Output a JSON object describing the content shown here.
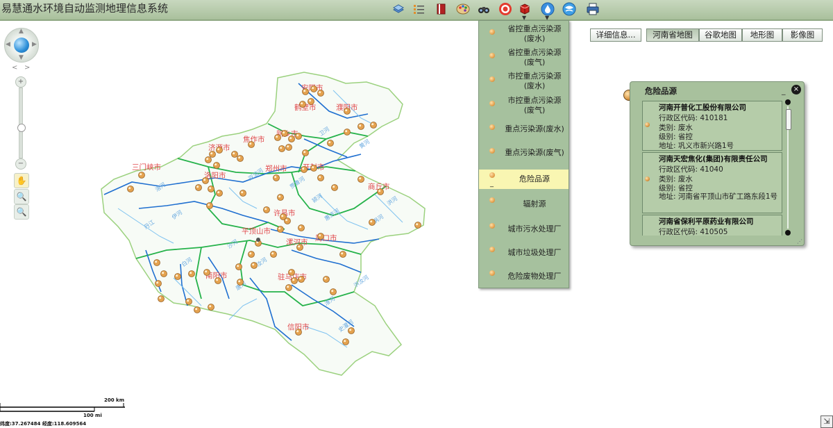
{
  "app": {
    "title": "易慧通水环境自动监测地理信息系统"
  },
  "toolbar": {
    "icons": [
      "layers-icon",
      "list-icon",
      "book-icon",
      "palette-icon",
      "binoculars-icon",
      "target-icon",
      "cube-icon",
      "water-drop-icon",
      "globe-icon",
      "printer-icon"
    ]
  },
  "map_types": {
    "detail_label": "详细信息...",
    "buttons": [
      "河南省地图",
      "谷歌地图",
      "地形图",
      "影像图"
    ],
    "active": "河南省地图"
  },
  "layer_menu": {
    "items": [
      "省控重点污染源(废水)",
      "省控重点污染源(废气)",
      "市控重点污染源(废水)",
      "市控重点污染源(废气)",
      "重点污染源(废水)",
      "重点污染源(废气)",
      "危险品源",
      "辐射源",
      "城市污水处理厂",
      "城市垃圾处理厂",
      "危险废物处理厂"
    ],
    "selected": "危险品源"
  },
  "popup": {
    "title": "危险品源",
    "minimize": "_",
    "close": "×",
    "records": [
      {
        "name": "河南开普化工股份有限公司",
        "code": "行政区代码: 410181",
        "type": "类别: 废水",
        "level": "级别: 省控",
        "address": "地址: 巩义市新兴路1号"
      },
      {
        "name": "河南天宏焦化(集团)有限责任公司",
        "code": "行政区代码: 41040",
        "type": "类别: 废水",
        "level": "级别: 省控",
        "address": "地址: 河南省平顶山市矿工路东段1号"
      },
      {
        "name": "河南省保利平原药业有限公司",
        "code": "行政区代码: 410505"
      }
    ]
  },
  "map": {
    "cities": [
      "安阳市",
      "鹤壁市",
      "濮阳市",
      "新乡市",
      "焦作市",
      "济源市",
      "三门峡市",
      "洛阳市",
      "郑州市",
      "开封市",
      "商丘市",
      "许昌市",
      "平顶山市",
      "漯河市",
      "周口市",
      "南阳市",
      "驻马店市",
      "信阳市"
    ],
    "rivers": [
      "卫河",
      "洛河",
      "伊河",
      "颍河",
      "沙河",
      "淮河",
      "汝河",
      "白河",
      "唐河",
      "洪河",
      "涡河",
      "惠济河",
      "贾鲁河",
      "洪汝河",
      "史灌河",
      "丹江",
      "双洎河",
      "黄河"
    ]
  },
  "scale": {
    "km": "200 km",
    "mi": "100 mi"
  },
  "coordinates": {
    "text": "纬度:37.267484  经度:118.609564"
  },
  "colors": {
    "toolbar_bg": "#b3c8a8",
    "panel_bg": "#a6c19e",
    "river": "#1f6fd0",
    "boundary": "#25b24a",
    "city_label": "#e0484b",
    "marker": "#e4a24f",
    "selected": "#f9f6b2"
  }
}
